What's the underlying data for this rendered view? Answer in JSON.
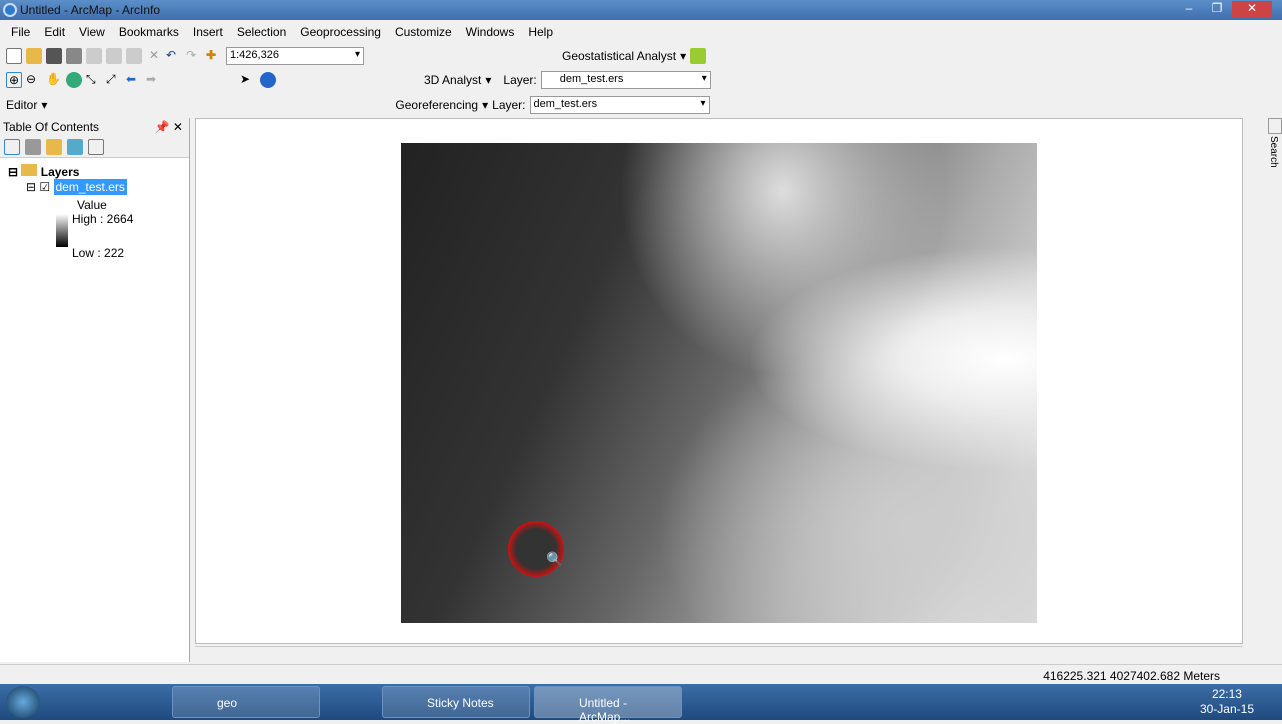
{
  "window": {
    "title": "Untitled - ArcMap - ArcInfo"
  },
  "menu": [
    "File",
    "Edit",
    "View",
    "Bookmarks",
    "Insert",
    "Selection",
    "Geoprocessing",
    "Customize",
    "Windows",
    "Help"
  ],
  "toolbar": {
    "scale": "1:426,326",
    "geostat": "Geostatistical Analyst",
    "analyst3d": "3D Analyst",
    "layer_label": "Layer:",
    "layer_value": "dem_test.ers",
    "editor": "Editor",
    "georef": "Georeferencing",
    "georef_layer": "dem_test.ers"
  },
  "toc": {
    "title": "Table Of Contents",
    "root": "Layers",
    "layer": "dem_test.ers",
    "value_label": "Value",
    "high": "High : 2664",
    "low": "Low : 222"
  },
  "search_tab": "Search",
  "status": {
    "coords": "416225.321  4027402.682 Meters"
  },
  "taskbar": {
    "items": [
      "geo",
      "Sticky Notes",
      "Untitled - ArcMap..."
    ],
    "time": "22:13",
    "date": "30-Jan-15"
  }
}
